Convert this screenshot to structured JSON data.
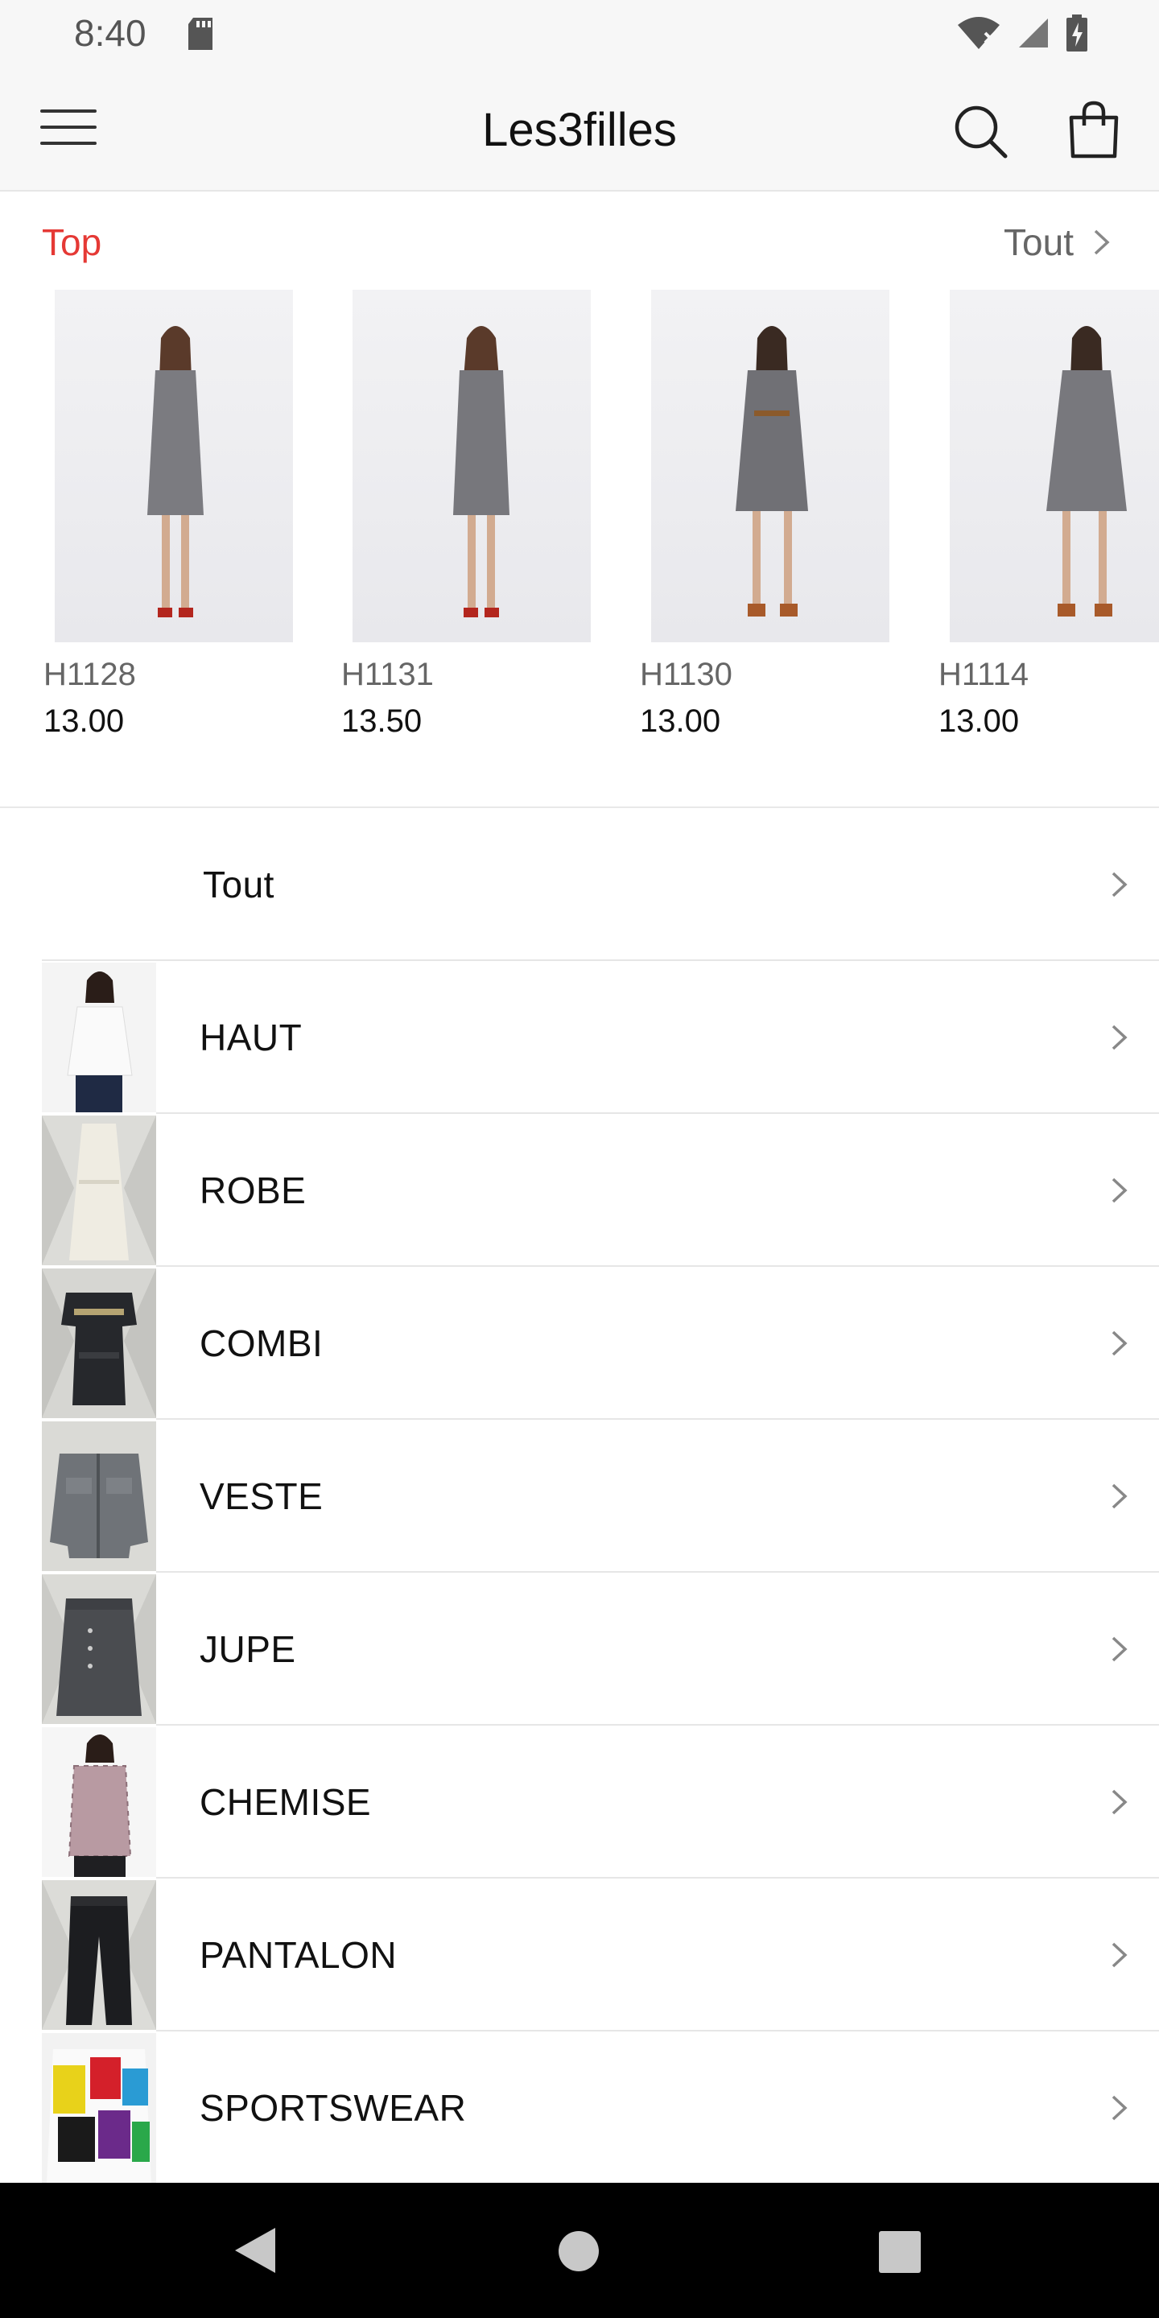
{
  "status": {
    "time": "8:40"
  },
  "app": {
    "title": "Les3filles"
  },
  "top": {
    "label": "Top",
    "all_label": "Tout",
    "products": [
      {
        "code": "H1128",
        "price": "13.00"
      },
      {
        "code": "H1131",
        "price": "13.50"
      },
      {
        "code": "H1130",
        "price": "13.00"
      },
      {
        "code": "H1114",
        "price": "13.00"
      }
    ]
  },
  "categories": {
    "all_label": "Tout",
    "items": [
      {
        "label": "HAUT"
      },
      {
        "label": "ROBE"
      },
      {
        "label": "COMBI"
      },
      {
        "label": "VESTE"
      },
      {
        "label": "JUPE"
      },
      {
        "label": "CHEMISE"
      },
      {
        "label": "PANTALON"
      },
      {
        "label": "SPORTSWEAR"
      }
    ]
  },
  "colors": {
    "accent": "#e53935",
    "header_bg": "#f7f7f7",
    "navbar_bg": "#000000"
  }
}
